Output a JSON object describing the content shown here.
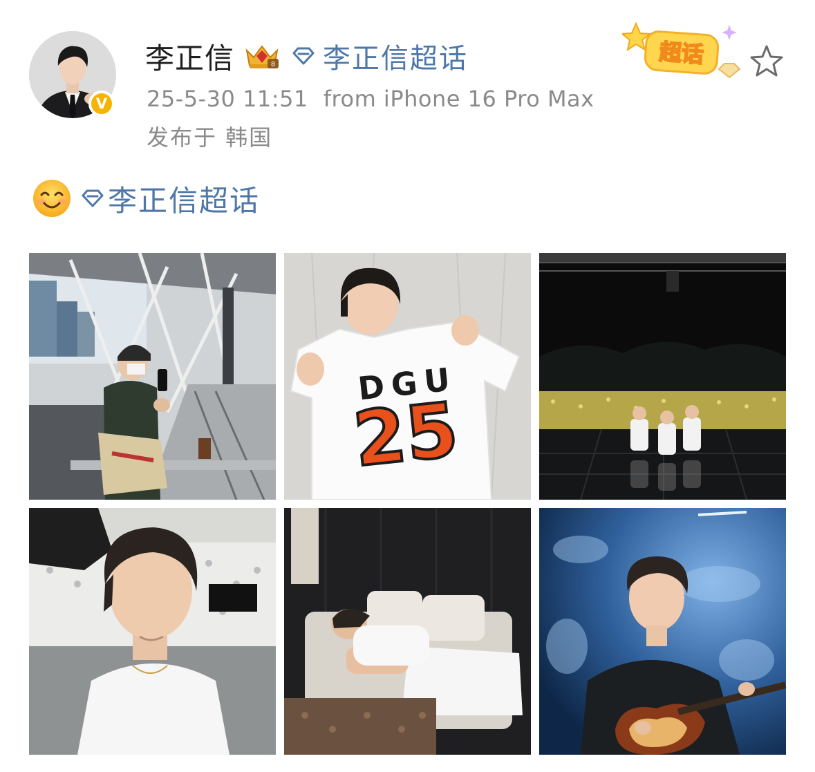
{
  "post": {
    "author": {
      "name": "李正信",
      "verified_mark": "V",
      "supertopic": "李正信超话"
    },
    "badge_label": "超话",
    "timestamp": "25-5-30 11:51",
    "source": "from iPhone 16 Pro Max",
    "location": "发布于 韩国",
    "content": {
      "emoji": "smile-emoji",
      "supertopic": "李正信超话"
    },
    "photos": {
      "jersey_text": "DGU",
      "jersey_number": "25"
    }
  },
  "colors": {
    "link_blue": "#4e77a8",
    "meta_gray": "#8a8a8a",
    "verified_gold": "#f5b400",
    "jersey_orange": "#e8501c"
  },
  "icons": {
    "crown": "crown-badge-icon",
    "diamond": "supertopic-diamond-icon",
    "star": "favorite-star-icon",
    "verified": "verified-v-icon"
  }
}
